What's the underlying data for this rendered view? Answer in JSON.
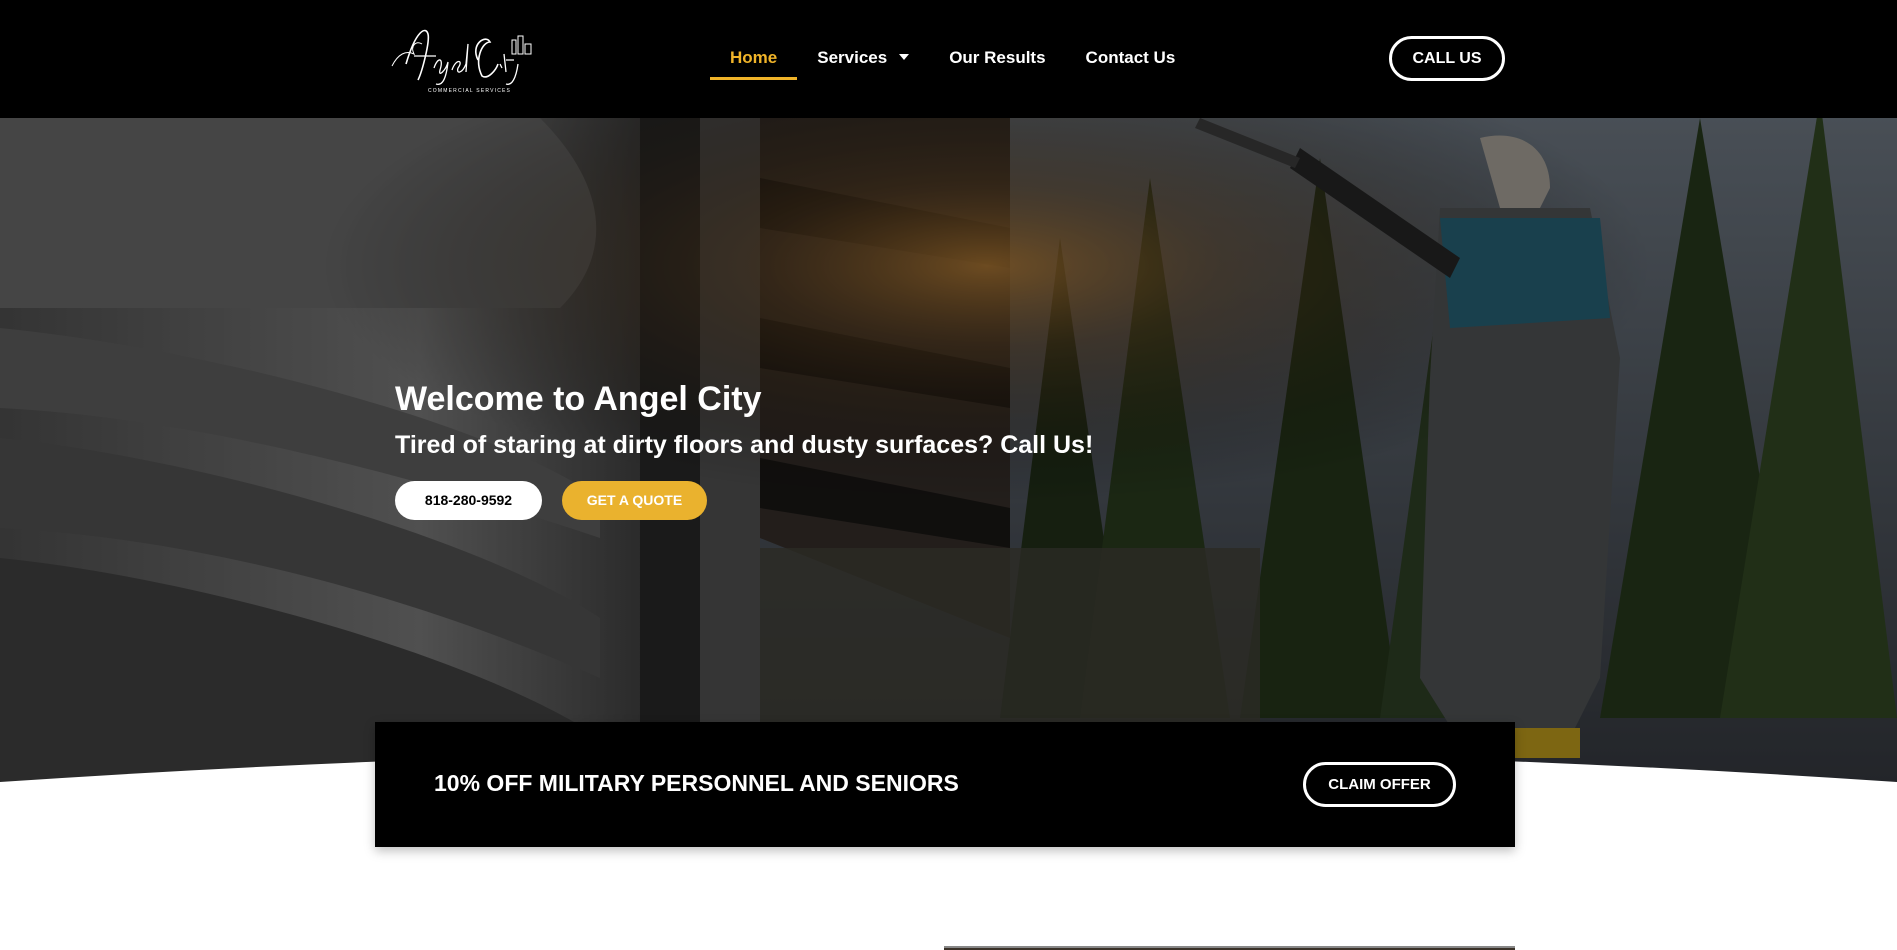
{
  "header": {
    "logo": {
      "text": "Angel City",
      "subtext": "COMMERCIAL SERVICES"
    },
    "nav": [
      {
        "label": "Home",
        "active": true
      },
      {
        "label": "Services",
        "has_dropdown": true
      },
      {
        "label": "Our Results"
      },
      {
        "label": "Contact Us"
      }
    ],
    "call_button": "CALL US"
  },
  "hero": {
    "title": "Welcome to Angel City",
    "subtitle": "Tired of staring at dirty floors and dusty surfaces? Call Us!",
    "phone_button": "818-280-9592",
    "quote_button": "GET A QUOTE"
  },
  "offer": {
    "text": "10% OFF MILITARY PERSONNEL AND SENIORS",
    "button": "CLAIM OFFER"
  },
  "colors": {
    "accent": "#eab22e",
    "header_bg": "#000000",
    "text_light": "#ffffff"
  }
}
